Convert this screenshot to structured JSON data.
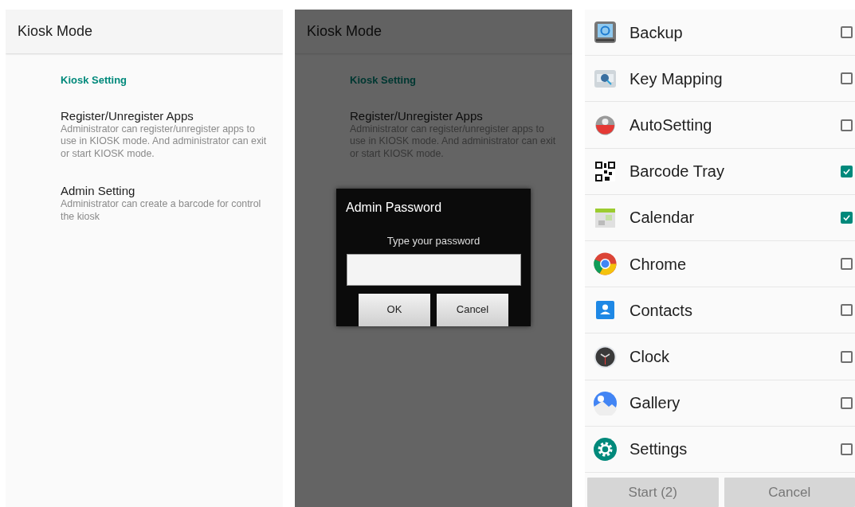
{
  "screens": [
    {
      "kind": "settings",
      "title": "Kiosk Mode",
      "section": "Kiosk Setting",
      "items": [
        {
          "title": "Register/Unregister Apps",
          "description": "Administrator can register/unregister apps to use in KIOSK mode. And administrator can exit or start KIOSK mode."
        },
        {
          "title": "Admin Setting",
          "description": "Administrator can create a barcode for control the kiosk"
        }
      ]
    },
    {
      "kind": "settings",
      "title": "Kiosk Mode",
      "section": "Kiosk Setting",
      "items": [
        {
          "title": "Register/Unregister Apps",
          "description": "Administrator can register/unregister apps to use in KIOSK mode. And administrator can exit or start KIOSK mode."
        }
      ],
      "dialog": {
        "title": "Admin Password",
        "message": "Type your password",
        "buttons": [
          "OK",
          "Cancel"
        ]
      }
    },
    {
      "kind": "app_list",
      "apps": [
        {
          "name": "Backup",
          "checked": false
        },
        {
          "name": "Key Mapping",
          "checked": false
        },
        {
          "name": "AutoSetting",
          "checked": false
        },
        {
          "name": "Barcode Tray",
          "checked": true
        },
        {
          "name": "Calendar",
          "checked": true
        },
        {
          "name": "Chrome",
          "checked": false
        },
        {
          "name": "Contacts",
          "checked": false
        },
        {
          "name": "Clock",
          "checked": false
        },
        {
          "name": "Gallery",
          "checked": false
        },
        {
          "name": "Settings",
          "checked": false
        }
      ],
      "buttons": [
        {
          "label": "Start (2)",
          "disabled": true
        },
        {
          "label": "Cancel",
          "disabled": true
        }
      ]
    }
  ]
}
